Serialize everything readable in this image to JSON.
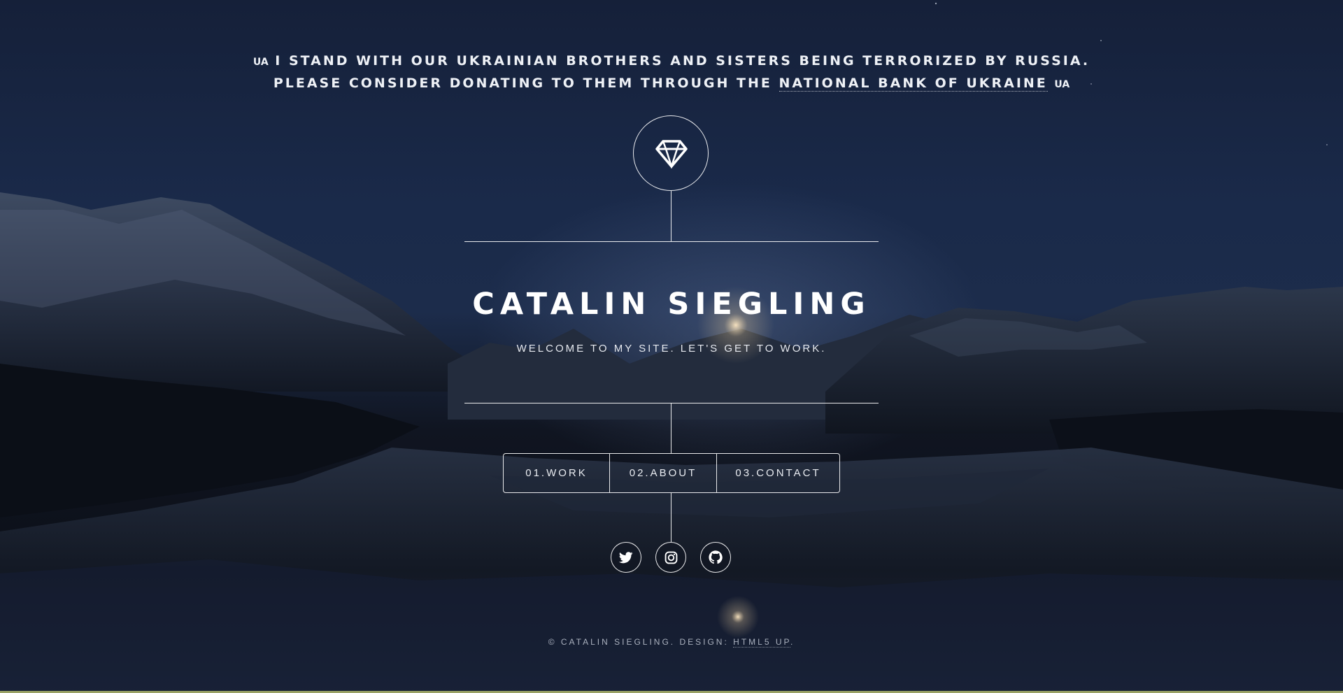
{
  "banner": {
    "flag_left": "UA",
    "line1": "I STAND WITH OUR UKRAINIAN BROTHERS AND SISTERS BEING TERRORIZED BY RUSSIA.",
    "line2_prefix": "PLEASE CONSIDER DONATING TO THEM THROUGH THE",
    "link_label": "NATIONAL BANK OF UKRAINE",
    "flag_right": "UA"
  },
  "header": {
    "logo_icon": "diamond-icon",
    "title": "CATALIN SIEGLING",
    "tagline": "WELCOME TO MY SITE. LET'S GET TO WORK."
  },
  "nav": {
    "items": [
      {
        "label": "01.WORK"
      },
      {
        "label": "02.ABOUT"
      },
      {
        "label": "03.CONTACT"
      }
    ]
  },
  "social": [
    {
      "icon": "twitter-icon"
    },
    {
      "icon": "instagram-icon"
    },
    {
      "icon": "github-icon"
    }
  ],
  "footer": {
    "copyright": "© CATALIN SIEGLING. DESIGN:",
    "design_link": "HTML5 UP",
    "suffix": "."
  },
  "colors": {
    "sky": "#1a2a4a",
    "foreground": "#ffffff",
    "muted": "#aab1be",
    "accent_strip": "#9aa266"
  }
}
